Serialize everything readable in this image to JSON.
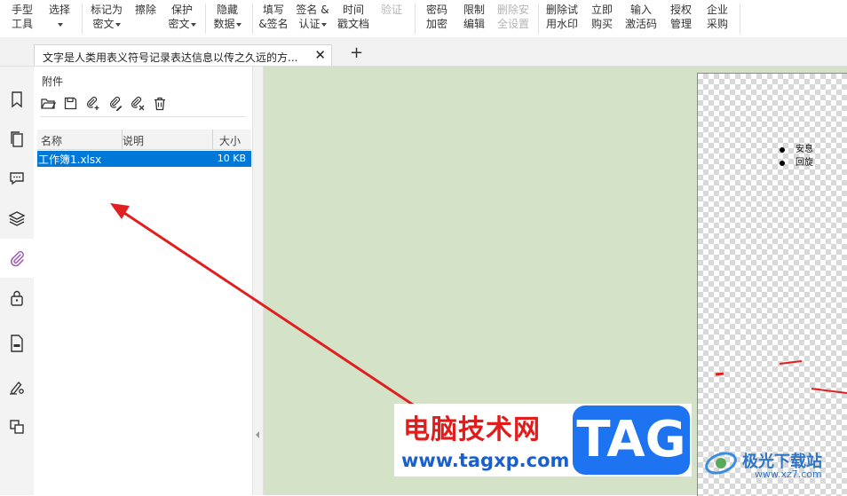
{
  "ribbon": {
    "buttons": [
      {
        "line1": "手型",
        "line2": "工具",
        "caret": false,
        "disabled": false
      },
      {
        "line1": "选择",
        "line2": "",
        "caret": true,
        "disabled": false
      },
      {
        "line1": "标记为",
        "line2": "密文",
        "caret": true,
        "disabled": false
      },
      {
        "line1": "擦除",
        "line2": "",
        "caret": false,
        "disabled": false
      },
      {
        "line1": "保护",
        "line2": "密文",
        "caret": true,
        "disabled": false
      },
      {
        "line1": "隐藏",
        "line2": "数据",
        "caret": true,
        "disabled": false
      },
      {
        "line1": "填写",
        "line2": "&签名",
        "caret": false,
        "disabled": false
      },
      {
        "line1": "签名 &",
        "line2": "认证",
        "caret": true,
        "disabled": false
      },
      {
        "line1": "时间",
        "line2": "戳文档",
        "caret": false,
        "disabled": false
      },
      {
        "line1": "验证",
        "line2": "",
        "caret": false,
        "disabled": true
      },
      {
        "line1": "密码",
        "line2": "加密",
        "caret": false,
        "disabled": false
      },
      {
        "line1": "限制",
        "line2": "编辑",
        "caret": false,
        "disabled": false
      },
      {
        "line1": "删除安",
        "line2": "全设置",
        "caret": false,
        "disabled": true
      },
      {
        "line1": "删除试",
        "line2": "用水印",
        "caret": false,
        "disabled": false
      },
      {
        "line1": "立即",
        "line2": "购买",
        "caret": false,
        "disabled": false
      },
      {
        "line1": "输入",
        "line2": "激活码",
        "caret": false,
        "disabled": false
      },
      {
        "line1": "授权",
        "line2": "管理",
        "caret": false,
        "disabled": false
      },
      {
        "line1": "企业",
        "line2": "采购",
        "caret": false,
        "disabled": false
      }
    ]
  },
  "tabs": {
    "document_title": "文字是人类用表义符号记录表达信息以传之久远的方...",
    "close_glyph": "✕",
    "add_glyph": "+"
  },
  "rail": {
    "items": [
      "bookmark-icon",
      "pages-icon",
      "comment-icon",
      "layers-icon",
      "attachment-icon",
      "security-lock-icon",
      "form-icon",
      "signature-icon",
      "compare-icon"
    ],
    "active": "attachment-icon"
  },
  "attachments_panel": {
    "title": "附件",
    "toolbar_icons": [
      "open-icon",
      "save-icon",
      "add-attachment-icon",
      "edit-attachment-icon",
      "remove-attachment-icon",
      "delete-icon"
    ],
    "columns": [
      "名称",
      "说明",
      "大小"
    ],
    "rows": [
      {
        "name": "工作簿1.xlsx",
        "description": "",
        "size": "10 KB",
        "selected": true
      }
    ]
  },
  "document": {
    "bullets": [
      "安息",
      "回旋"
    ]
  },
  "watermark": {
    "site_name": "电脑技术网",
    "site_url": "www.tagxp.com",
    "tag_text": "TAG",
    "brand_name": "极光下载站",
    "brand_url": "www.xz7.com"
  },
  "colors": {
    "selection": "#0078d7",
    "doc_background": "#d4e3c8",
    "annotation_red": "#e02020",
    "accent_purple": "#9b59b6"
  }
}
